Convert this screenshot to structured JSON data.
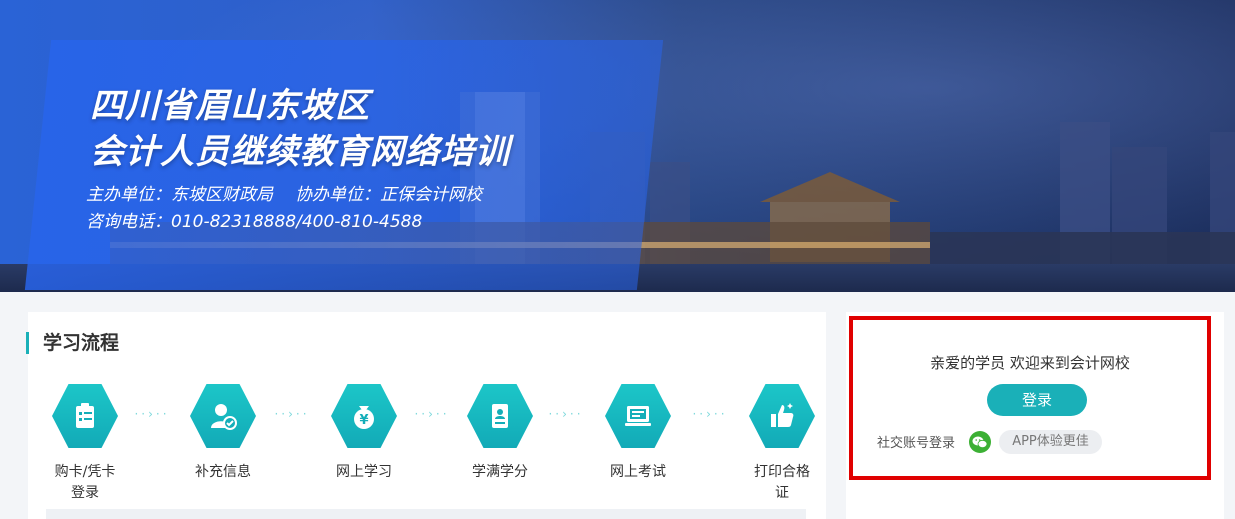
{
  "banner": {
    "title_line1": "四川省眉山东坡区",
    "title_line2": "会计人员继续教育网络培训",
    "host_label": "主办单位：东坡区财政局",
    "co_host_label": "协办单位：正保会计网校",
    "phone_label": "咨询电话：010-82318888/400-810-4588"
  },
  "process": {
    "title": "学习流程",
    "steps": [
      {
        "label_line1": "购卡/凭卡",
        "label_line2": "登录",
        "icon": "clipboard-icon"
      },
      {
        "label_line1": "补充信息",
        "label_line2": "",
        "icon": "user-check-icon"
      },
      {
        "label_line1": "网上学习",
        "label_line2": "",
        "icon": "money-bag-icon"
      },
      {
        "label_line1": "学满学分",
        "label_line2": "",
        "icon": "id-card-icon"
      },
      {
        "label_line1": "网上考试",
        "label_line2": "",
        "icon": "monitor-icon"
      },
      {
        "label_line1": "打印合格",
        "label_line2": "证",
        "icon": "thumbs-up-icon"
      }
    ]
  },
  "login_panel": {
    "welcome": "亲爱的学员 欢迎来到会计网校",
    "login_button": "登录",
    "social_label": "社交账号登录",
    "app_label": "APP体验更佳",
    "wechat_icon": "wechat-icon"
  },
  "colors": {
    "accent": "#1ab0b8",
    "highlight_border": "#e00000",
    "banner_blue": "#2a63d6"
  }
}
